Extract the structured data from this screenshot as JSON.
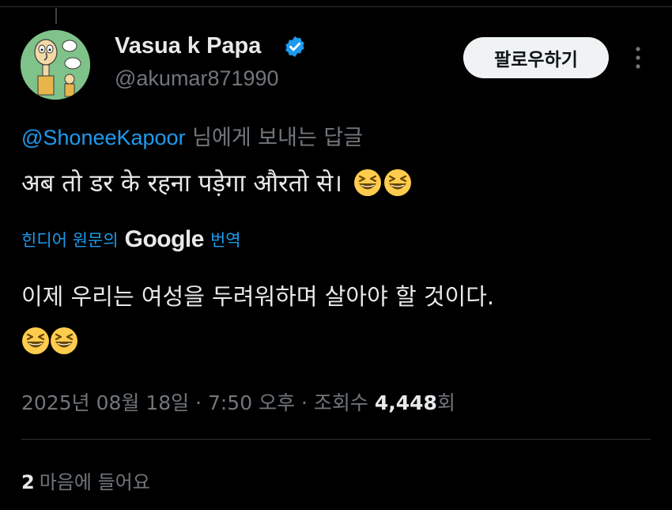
{
  "colors": {
    "background": "#000000",
    "primary_text": "#e7e9ea",
    "secondary_text": "#71767b",
    "accent_blue": "#1d9bf0",
    "divider": "#2f3336",
    "follow_button_bg": "#eff3f4"
  },
  "author": {
    "display_name": "Vasua k Papa",
    "handle": "@akumar871990",
    "verified_icon": "verified-badge-icon",
    "avatar_icon": "cartoon-avatar"
  },
  "follow_button": {
    "label": "팔로우하기"
  },
  "more_icon": "more-vertical-icon",
  "reply": {
    "mention": "@ShoneeKapoor",
    "suffix": "님에게 보내는 답글"
  },
  "tweet": {
    "text": "अब तो डर के रहना पड़ेगा औरतो से।",
    "emoji": "grinning-squinting-face-emoji"
  },
  "translation": {
    "prefix": "힌디어 원문의",
    "provider": "Google",
    "suffix": "번역",
    "text": "이제 우리는 여성을 두려워하며 살아야 할 것이다."
  },
  "meta": {
    "date_time": "2025년 08월 18일 · 7:50 오후 · 조회수 ",
    "views": "4,448",
    "views_suffix": "회"
  },
  "likes": {
    "count": "2",
    "label": "마음에 들어요"
  }
}
